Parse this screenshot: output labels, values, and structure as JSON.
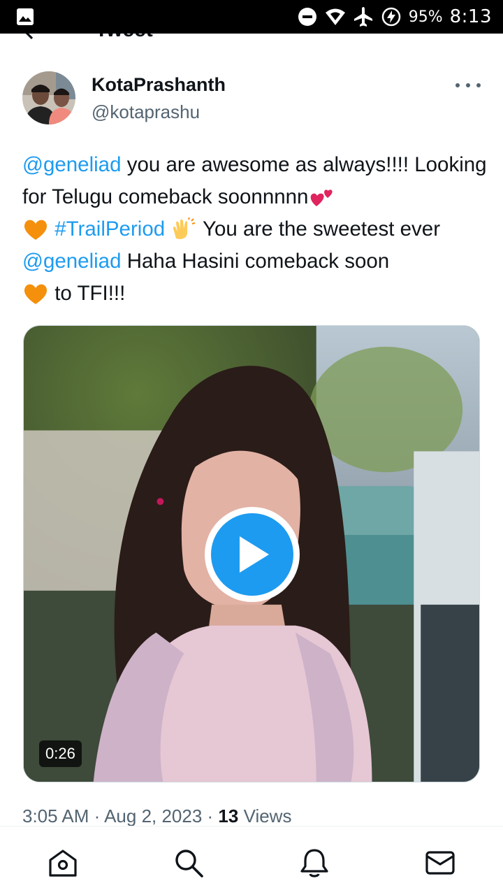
{
  "status_bar": {
    "battery_text": "95%",
    "time": "8:13",
    "icons": [
      "gallery-icon",
      "dnd-icon",
      "wifi-icon",
      "airplane-icon",
      "battery-charging-icon"
    ]
  },
  "header": {
    "title": "Tweet",
    "back_icon": "back-arrow-icon"
  },
  "tweet": {
    "author": {
      "name": "KotaPrashanth",
      "handle": "@kotaprashu"
    },
    "text": {
      "mention1": "@geneliad",
      "part1": " you are awesome as always!!!! Looking for Telugu comeback soonnnnn",
      "emoji_hearts": "two-hearts-emoji",
      "emoji_orange_heart": "orange-heart-emoji",
      "hashtag": "#TrailPeriod",
      "emoji_clap": "clapping-hands-emoji",
      "part2": " You are the sweetest ever ",
      "mention2": "@geneliad",
      "part3": " Haha Hasini comeback soon ",
      "part4": " to TFI!!!"
    },
    "video": {
      "duration": "0:26"
    },
    "meta": {
      "time": "3:05 AM",
      "sep1": " · ",
      "date": "Aug 2, 2023",
      "sep2": " · ",
      "views_count": "13",
      "views_label": " Views"
    }
  },
  "bottom_nav": {
    "items": [
      "home-icon",
      "search-icon",
      "notifications-icon",
      "messages-icon"
    ]
  },
  "colors": {
    "accent": "#1d9bf0",
    "secondary_text": "#536471",
    "primary_text": "#0f1419"
  }
}
